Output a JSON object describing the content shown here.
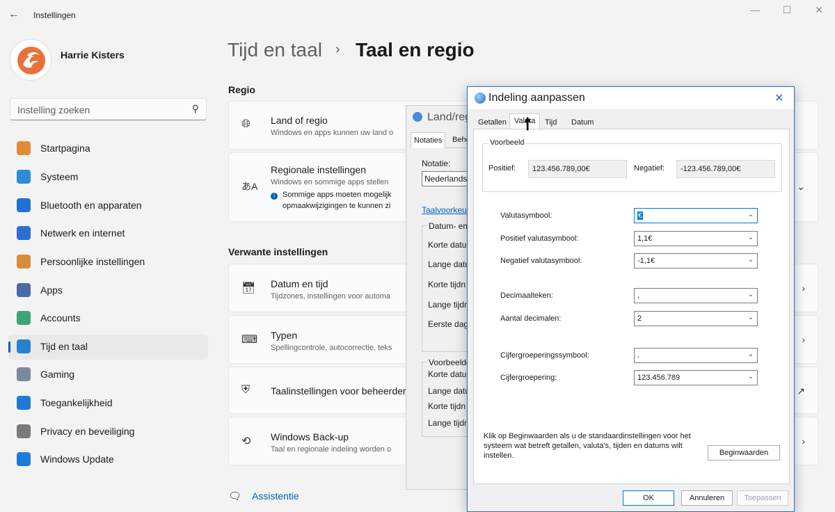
{
  "window": {
    "title": "Instellingen",
    "controls": [
      "—",
      "☐",
      "✕"
    ]
  },
  "profile": {
    "name": "Harrie Kisters"
  },
  "search": {
    "placeholder": "Instelling zoeken"
  },
  "nav": {
    "items": [
      {
        "label": "Startpagina",
        "color": "#e38a3a"
      },
      {
        "label": "Systeem",
        "color": "#2d8cd8"
      },
      {
        "label": "Bluetooth en apparaten",
        "color": "#1f73d1"
      },
      {
        "label": "Netwerk en internet",
        "color": "#2e6fd1"
      },
      {
        "label": "Persoonlijke instellingen",
        "color": "#d98b3a"
      },
      {
        "label": "Apps",
        "color": "#4a6aa8"
      },
      {
        "label": "Accounts",
        "color": "#3aa57a"
      },
      {
        "label": "Tijd en taal",
        "color": "#2a7fd0"
      },
      {
        "label": "Gaming",
        "color": "#7a8a9a"
      },
      {
        "label": "Toegankelijkheid",
        "color": "#1f7bd6"
      },
      {
        "label": "Privacy en beveiliging",
        "color": "#7a7a7a"
      },
      {
        "label": "Windows Update",
        "color": "#1f7bd6"
      }
    ],
    "active_index": 7
  },
  "breadcrumb": {
    "parent": "Tijd en taal",
    "sep": "›",
    "current": "Taal en regio"
  },
  "region": {
    "heading": "Regio",
    "cards": [
      {
        "title": "Land of regio",
        "sub": "Windows en apps kunnen uw land o"
      },
      {
        "title": "Regionale instellingen",
        "sub": "Windows en sommige apps stellen",
        "note1": "Sommige apps moeten mogelijk",
        "note2": "opmaakwijzigingen te kunnen zi"
      }
    ]
  },
  "related": {
    "heading": "Verwante instellingen",
    "cards": [
      {
        "title": "Datum en tijd",
        "sub": "Tijdzones, instellingen voor automa"
      },
      {
        "title": "Typen",
        "sub": "Spellingcontrole, autocorrectie, teks"
      },
      {
        "title": "Taalinstellingen voor beheerder",
        "sub": ""
      },
      {
        "title": "Windows Back-up",
        "sub": "Taal en regionale indeling worden o"
      }
    ]
  },
  "assist": {
    "label": "Assistentie"
  },
  "dialog2": {
    "title": "Land/regio",
    "tabs": [
      "Notaties",
      "Behe"
    ],
    "notatie_label": "Notatie:",
    "notatie_value": "Nederlands",
    "taalvoorkeur": "Taalvoorkeu",
    "group1": "Datum- en",
    "rows1": [
      "Korte datu",
      "Lange datu",
      "Korte tijdn",
      "Lange tijdn",
      "Eerste dag"
    ],
    "group2": "Voorbeelde",
    "rows2": [
      "Korte datu",
      "Lange datu",
      "Korte tijdn",
      "Lange tijdn"
    ]
  },
  "dialog": {
    "title": "Indeling aanpassen",
    "tabs": [
      "Getallen",
      "Valuta",
      "Tijd",
      "Datum"
    ],
    "active_tab": 1,
    "example": {
      "group": "Voorbeeld",
      "pos_label": "Positief:",
      "pos_value": "123.456.789,00€",
      "neg_label": "Negatief:",
      "neg_value": "-123.456.789,00€"
    },
    "fields": [
      {
        "label": "Valutasymbool:",
        "value": "€"
      },
      {
        "label": "Positief valutasymbool:",
        "value": "1,1€"
      },
      {
        "label": "Negatief valutasymbool:",
        "value": "-1,1€"
      },
      {
        "label": "Decimaalteken:",
        "value": ","
      },
      {
        "label": "Aantal decimalen:",
        "value": "2"
      },
      {
        "label": "Cijfergroeperingssymbool:",
        "value": "."
      },
      {
        "label": "Cijfergroepering:",
        "value": "123.456.789"
      }
    ],
    "note": "Klik op Beginwaarden als u de standaardinstellingen voor het systeem wat betreft getallen, valuta's, tijden en datums wilt instellen.",
    "reset_btn": "Beginwaarden",
    "ok": "OK",
    "cancel": "Annuleren",
    "apply": "Toepassen"
  }
}
